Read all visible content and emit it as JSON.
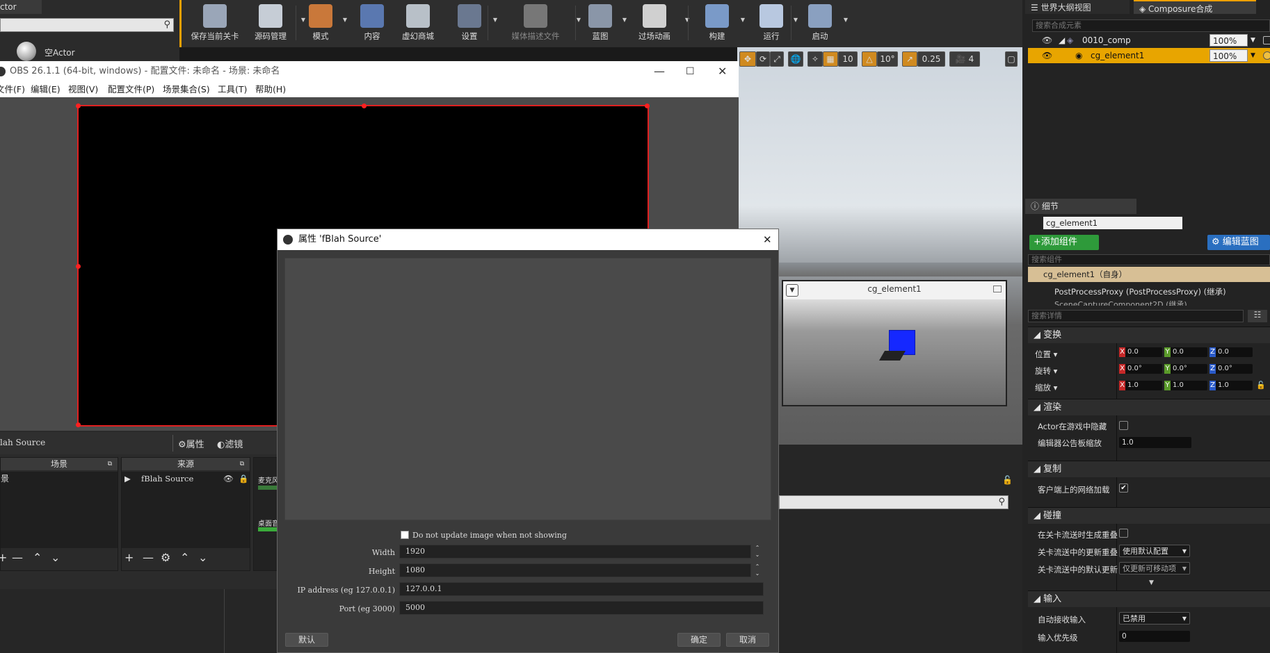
{
  "ue": {
    "left_tab": "ctor",
    "actor_label": "空Actor",
    "toolbar": [
      {
        "label": "保存当前关卡",
        "color": "#9aa6b8"
      },
      {
        "label": "源码管理",
        "color": "#c6cdd6"
      },
      {
        "label": "模式",
        "color": "#c9783a"
      },
      {
        "label": "内容",
        "color": "#5a78b0"
      },
      {
        "label": "虚幻商城",
        "color": "#b8c0c8"
      },
      {
        "label": "设置",
        "color": "#6a7890"
      },
      {
        "label": "媒体描述文件",
        "color": "#777777"
      },
      {
        "label": "蓝图",
        "color": "#8a96a8"
      },
      {
        "label": "过场动画",
        "color": "#d0d0d0"
      },
      {
        "label": "构建",
        "color": "#7a9ac8"
      },
      {
        "label": "运行",
        "color": "#b8c8e0"
      },
      {
        "label": "启动",
        "color": "#8aa0c0"
      }
    ],
    "viewport": {
      "grid_snap": "10",
      "rot_snap": "10°",
      "scale_snap": "0.25",
      "cam_speed": "4",
      "pip_title": "cg_element1"
    },
    "composure": {
      "tab_outliner": "世界大纲视图",
      "tab_composure": "Composure合成",
      "search_placeholder": "搜索合成元素",
      "rows": [
        {
          "name": "0010_comp",
          "opacity": "100%"
        },
        {
          "name": "cg_element1",
          "opacity": "100%"
        }
      ]
    },
    "details": {
      "tab": "细节",
      "actor_name": "cg_element1",
      "add_component": "+添加组件",
      "edit_blueprint": "编辑蓝图",
      "search_component": "搜索组件",
      "self_row": "cg_element1（自身）",
      "component_row": "PostProcessProxy (PostProcessProxy) (继承)",
      "component_row2": "SceneCaptureComponent2D (继承)",
      "search_details": "搜索详情",
      "transform": {
        "section": "变换",
        "location": {
          "label": "位置",
          "x": "0.0",
          "y": "0.0",
          "z": "0.0"
        },
        "rotation": {
          "label": "旋转",
          "x": "0.0°",
          "y": "0.0°",
          "z": "0.0°"
        },
        "scale": {
          "label": "缩放",
          "x": "1.0",
          "y": "1.0",
          "z": "1.0"
        }
      },
      "render": {
        "section": "渲染",
        "hidden_label": "Actor在游戏中隐藏",
        "hidden": false,
        "billboard_label": "编辑器公告板缩放",
        "billboard_value": "1.0"
      },
      "replication": {
        "section": "复制",
        "net_load_label": "客户端上的网络加载",
        "net_load": true
      },
      "collision": {
        "section": "碰撞",
        "overlap_label": "在关卡流送时生成重叠",
        "overlap": false,
        "update_label": "关卡流送中的更新重叠",
        "update_value": "使用默认配置",
        "default_label": "关卡流送中的默认更新",
        "default_value": "仅更新可移动项"
      },
      "input": {
        "section": "输入",
        "auto_label": "自动接收输入",
        "auto_value": "已禁用",
        "priority_label": "输入优先级",
        "priority_value": "0"
      }
    }
  },
  "obs": {
    "title": "OBS 26.1.1 (64-bit, windows) - 配置文件: 未命名 - 场景: 未命名",
    "menu": [
      "文件(F)",
      "编辑(E)",
      "视图(V)",
      "配置文件(P)",
      "场景集合(S)",
      "工具(T)",
      "帮助(H)"
    ],
    "selected_source": "lah Source",
    "properties_button": "属性",
    "filters_button": "滤镜",
    "docks": {
      "scenes_header": "场景",
      "scene_item": "景",
      "sources_header": "来源",
      "source_item": "fBlah Source",
      "mixer_item1": "麦克风",
      "mixer_item2": "桌面音"
    }
  },
  "dialog": {
    "title": "属性 'fBlah Source'",
    "checkbox_label": "Do not update image when not showing",
    "checkbox_checked": false,
    "fields": [
      {
        "label": "Width",
        "value": "1920"
      },
      {
        "label": "Height",
        "value": "1080"
      },
      {
        "label": "IP address (eg 127.0.0.1)",
        "value": "127.0.0.1"
      },
      {
        "label": "Port (eg 3000)",
        "value": "5000"
      }
    ],
    "defaults_button": "默认",
    "ok_button": "确定",
    "cancel_button": "取消"
  }
}
